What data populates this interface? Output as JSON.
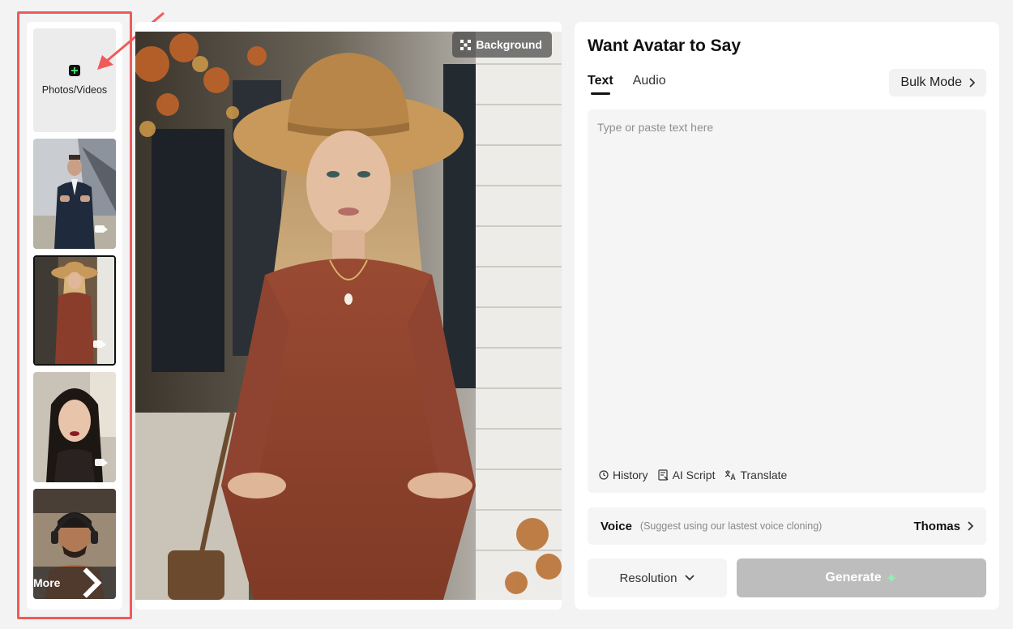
{
  "left_strip": {
    "upload_label": "Photos/Videos",
    "more_label": "More",
    "thumbnails": [
      {
        "subject": "man in suit",
        "has_video": true
      },
      {
        "subject": "woman in hat",
        "has_video": true,
        "selected": true
      },
      {
        "subject": "woman with dark hair",
        "has_video": true
      },
      {
        "subject": "man with headphones",
        "has_video": true
      }
    ]
  },
  "preview": {
    "background_button": "Background"
  },
  "panel": {
    "title": "Want Avatar to Say",
    "tabs": [
      {
        "label": "Text",
        "active": true
      },
      {
        "label": "Audio",
        "active": false
      }
    ],
    "bulk_mode_label": "Bulk Mode",
    "text_placeholder": "Type or paste text here",
    "tools": [
      {
        "label": "History",
        "icon": "clock-icon"
      },
      {
        "label": "AI Script",
        "icon": "script-icon"
      },
      {
        "label": "Translate",
        "icon": "translate-icon"
      }
    ],
    "voice": {
      "label": "Voice",
      "hint": "(Suggest using our lastest voice cloning)",
      "value": "Thomas"
    },
    "resolution_label": "Resolution",
    "generate_label": "Generate"
  },
  "colors": {
    "annotation": "#ef5b5b",
    "generate_disabled": "#bdbdbd",
    "sparkle": "#8ff0b0"
  }
}
